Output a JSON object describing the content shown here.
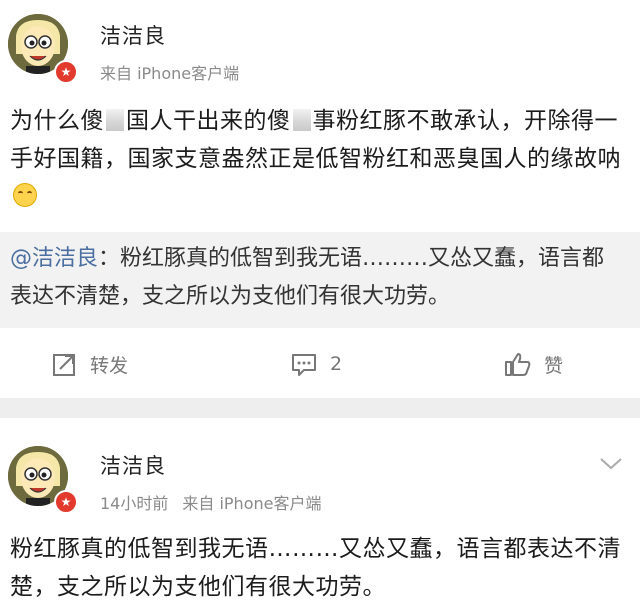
{
  "post": {
    "username": "洁洁良",
    "source": "来自 iPhone客户端",
    "text_part1": "为什么傻",
    "text_part2": "国人干出来的傻",
    "text_part3": "事粉红豚不敢承认，开除得一手好国籍，国家支意盎然正是低智粉红和恶臭国人的缘故呐",
    "emoji": "smile-emoji",
    "quote_author": "@洁洁良",
    "quote_text": "：粉红豚真的低智到我无语………又怂又蠢，语言都表达不清楚，支之所以为支他们有很大功劳。",
    "actions": {
      "repost_label": "转发",
      "comment_count": "2",
      "like_label": "赞"
    }
  },
  "reply": {
    "username": "洁洁良",
    "time": "14小时前",
    "source": "来自 iPhone客户端",
    "text": "粉红豚真的低智到我无语………又怂又蠢，语言都表达不清楚，支之所以为支他们有很大功劳。"
  },
  "colors": {
    "link": "#4a6fa0",
    "badge": "#e23b2e",
    "divider": "#eeeeee",
    "quote_bg": "#f2f2f2"
  },
  "icons": [
    "repost-icon",
    "comment-icon",
    "like-icon",
    "chevron-down-icon",
    "verified-badge-icon"
  ]
}
